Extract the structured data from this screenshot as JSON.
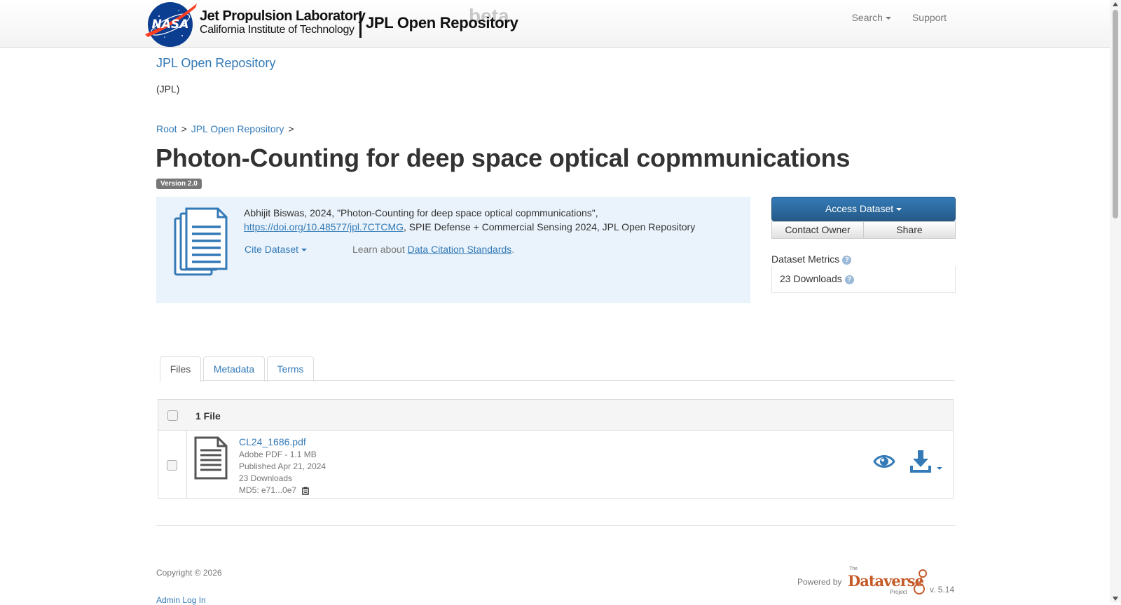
{
  "navbar": {
    "logo_line1": "Jet Propulsion Laboratory",
    "logo_line2": "California Institute of Technology",
    "repo_name": "JPL Open Repository",
    "beta_label": "beta",
    "search_label": "Search",
    "support_label": "Support"
  },
  "dataverse": {
    "title": "JPL Open Repository",
    "affiliation": "(JPL)"
  },
  "breadcrumb": {
    "items": [
      "Root",
      "JPL Open Repository"
    ],
    "separator": ">"
  },
  "dataset": {
    "title": "Photon-Counting for deep space optical copmmunications",
    "version": "Version 2.0",
    "citation_prefix": "Abhijit Biswas, 2024, \"Photon-Counting for deep space optical copmmunications\", ",
    "doi_link": "https://doi.org/10.48577/jpl.7CTCMG",
    "citation_suffix": ", SPIE Defense + Commercial Sensing 2024, JPL Open Repository",
    "cite_dataset_label": "Cite Dataset",
    "learn_about_prefix": "Learn about ",
    "learn_about_link": "Data Citation Standards",
    "learn_about_suffix": "."
  },
  "actions": {
    "access_dataset": "Access Dataset",
    "contact_owner": "Contact Owner",
    "share": "Share"
  },
  "metrics": {
    "label": "Dataset Metrics",
    "downloads": "23 Downloads",
    "help_glyph": "?"
  },
  "tabs": [
    {
      "label": "Files",
      "active": true
    },
    {
      "label": "Metadata",
      "active": false
    },
    {
      "label": "Terms",
      "active": false
    }
  ],
  "files": {
    "count_label": "1 File",
    "rows": [
      {
        "name": "CL24_1686.pdf",
        "type_size": "Adobe PDF - 1.1 MB",
        "published": "Published Apr 21, 2024",
        "downloads": "23 Downloads",
        "md5": "MD5: e71...0e7"
      }
    ]
  },
  "footer": {
    "copyright": "Copyright © 2026",
    "admin_login": "Admin Log In",
    "powered_by": "Powered by",
    "dataverse_the": "The",
    "dataverse_word": "Dataverse",
    "dataverse_project": "Project",
    "version": "v. 5.14"
  },
  "colors": {
    "link": "#337ab7",
    "primary_button": "#2e6da4",
    "citation_bg": "#eaf3fb",
    "nasa_blue": "#0b3d91",
    "nasa_red": "#fc3d21",
    "dataverse_orange": "#c55b28"
  },
  "icons": {
    "nasa_logo": "nasa-meatball-icon",
    "dataset": "stacked-documents-icon",
    "file": "document-icon",
    "preview": "eye-icon",
    "download": "download-icon",
    "copy": "clipboard-icon"
  }
}
